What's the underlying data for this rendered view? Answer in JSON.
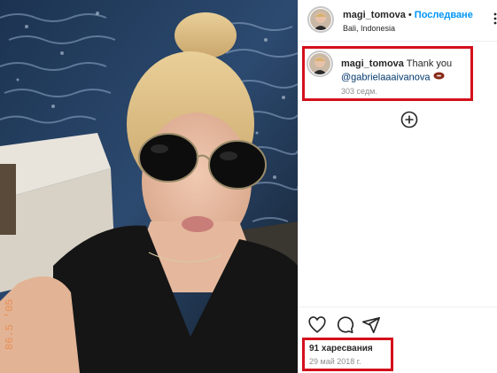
{
  "post": {
    "username": "magi_tomova",
    "separator": "•",
    "follow_label": "Последване",
    "location": "Bali, Indonesia"
  },
  "comment": {
    "username": "magi_tomova",
    "text": "Thank you",
    "mention": "@gabrielaaaivanova",
    "time": "303 седм."
  },
  "footer": {
    "likes": "91 харесвания",
    "date": "29 май 2018 г."
  },
  "photo_watermark": "86.5 '05",
  "colors": {
    "follow": "#0095f6",
    "highlight": "#d3101b",
    "mention": "#00376b"
  },
  "icons": [
    "more-icon",
    "football-icon",
    "add-icon",
    "heart-icon",
    "comment-icon",
    "share-icon"
  ]
}
